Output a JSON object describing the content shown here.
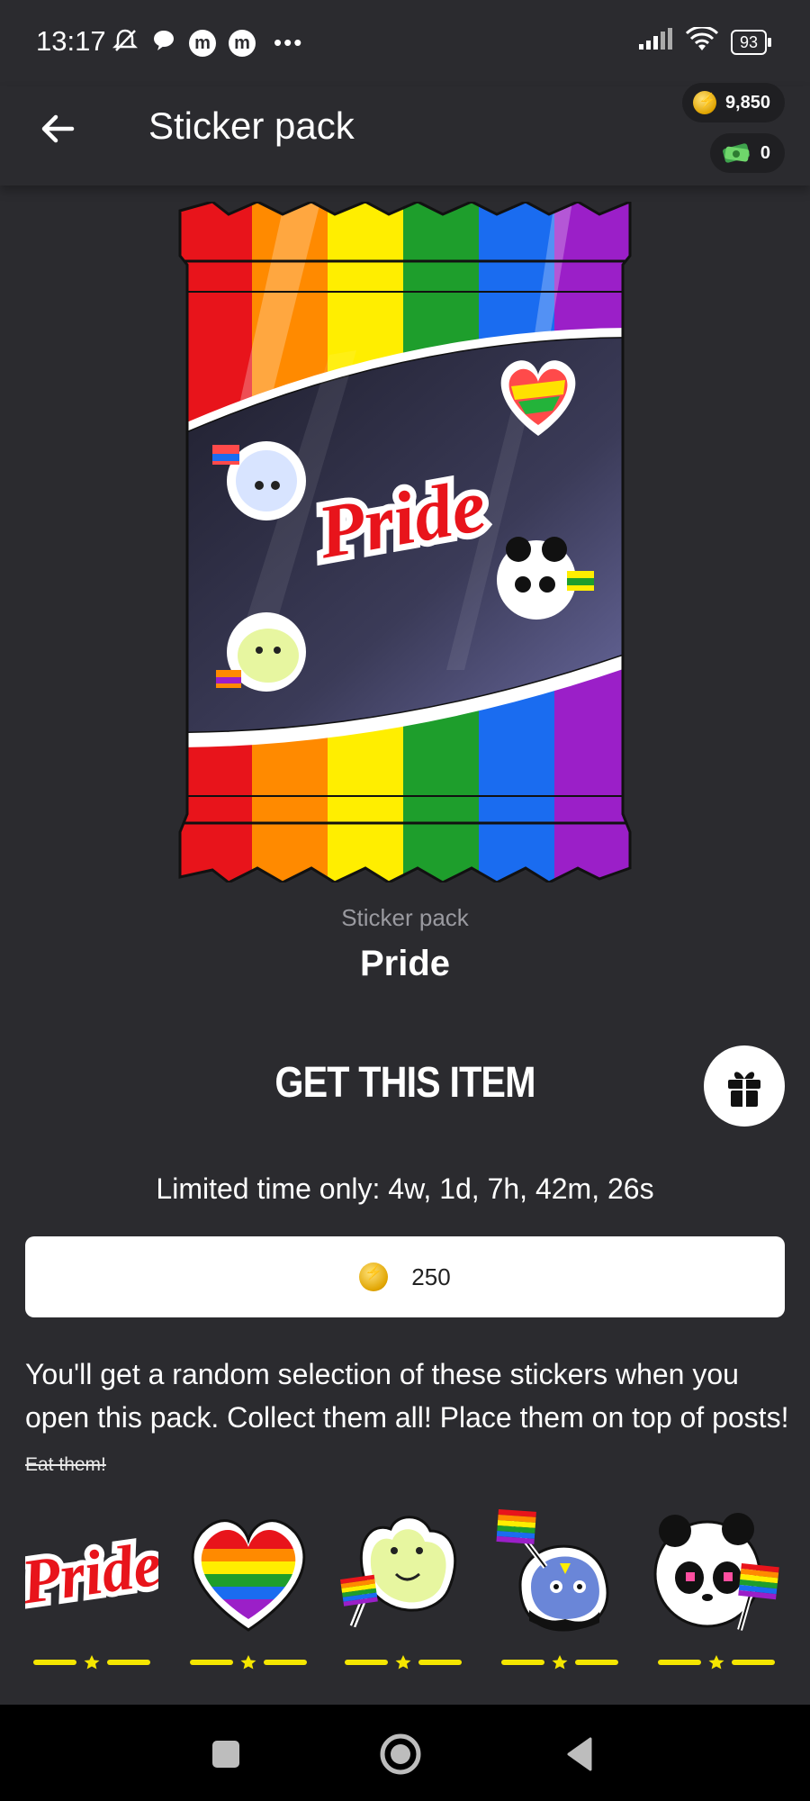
{
  "status_bar": {
    "time": "13:17",
    "battery": "93"
  },
  "header": {
    "title": "Sticker pack",
    "coins": "9,850",
    "cash": "0"
  },
  "item": {
    "type_label": "Sticker pack",
    "name": "Pride",
    "pack_artwork_text": "Pride"
  },
  "purchase": {
    "section_title": "GET THIS ITEM",
    "limited_time": "Limited time only: 4w, 1d, 7h, 42m, 26s",
    "price": "250",
    "description": "You'll get a random selection of these stickers when you open this pack. Collect them all! Place them on top of posts!",
    "description_strike": "Eat them!"
  },
  "stickers": [
    {
      "name": "pride-text-sticker",
      "label": "Pride"
    },
    {
      "name": "rainbow-heart-sticker"
    },
    {
      "name": "frog-flag-sticker"
    },
    {
      "name": "ghost-flag-sticker"
    },
    {
      "name": "panda-flag-sticker"
    }
  ],
  "colors": {
    "background": "#2b2b2f",
    "rarity": "#f5e600",
    "rainbow": [
      "#e8141b",
      "#ff8a00",
      "#ffee00",
      "#1e9e2c",
      "#1a6cf0",
      "#9b1fc8"
    ]
  }
}
